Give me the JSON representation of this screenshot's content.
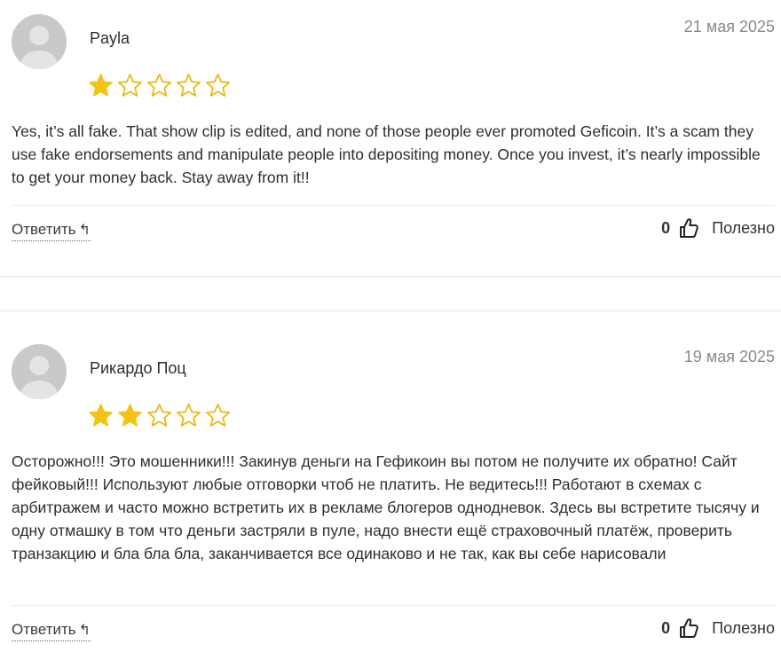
{
  "reviews": [
    {
      "author": "Payla",
      "date": "21 мая 2025",
      "rating": 1,
      "max_rating": 5,
      "text": "Yes, it’s all fake. That show clip is edited, and none of those people ever promoted Geficoin. It’s a scam they use fake endorsements and manipulate people into depositing money. Once you invest, it’s nearly impossible to get your money back. Stay away from it!!",
      "reply_label": "Ответить",
      "reply_icon": "↰",
      "vote_count": "0",
      "useful_label": "Полезно"
    },
    {
      "author": "Рикардо Поц",
      "date": "19 мая 2025",
      "rating": 2,
      "max_rating": 5,
      "text": "Осторожно!!! Это мошенники!!! Закинув деньги на Гефикоин вы потом не получите их обратно! Сайт фейковый!!! Используют любые отговорки чтоб не платить. Не ведитесь!!! Работают в схемах с арбитражем и часто можно встретить их в рекламе блогеров однодневок. Здесь вы встретите тысячу и одну отмашку в том что деньги застряли в пуле, надо внести ещё страховочный платёж, проверить транзакцию и бла бла бла, заканчивается все одинаково и не так, как вы себе нарисовали",
      "reply_label": "Ответить",
      "reply_icon": "↰",
      "vote_count": "0",
      "useful_label": "Полезно"
    }
  ],
  "colors": {
    "star_filled": "#f2c314",
    "star_outline": "#e8b80f",
    "avatar_bg": "#c9c9c9",
    "avatar_fg": "#e4e4e4",
    "date": "#8a8a8a"
  },
  "icons": {
    "avatar": "avatar-placeholder-icon",
    "star": "star-icon",
    "reply": "reply-arrow-icon",
    "thumb": "thumbs-up-icon"
  }
}
